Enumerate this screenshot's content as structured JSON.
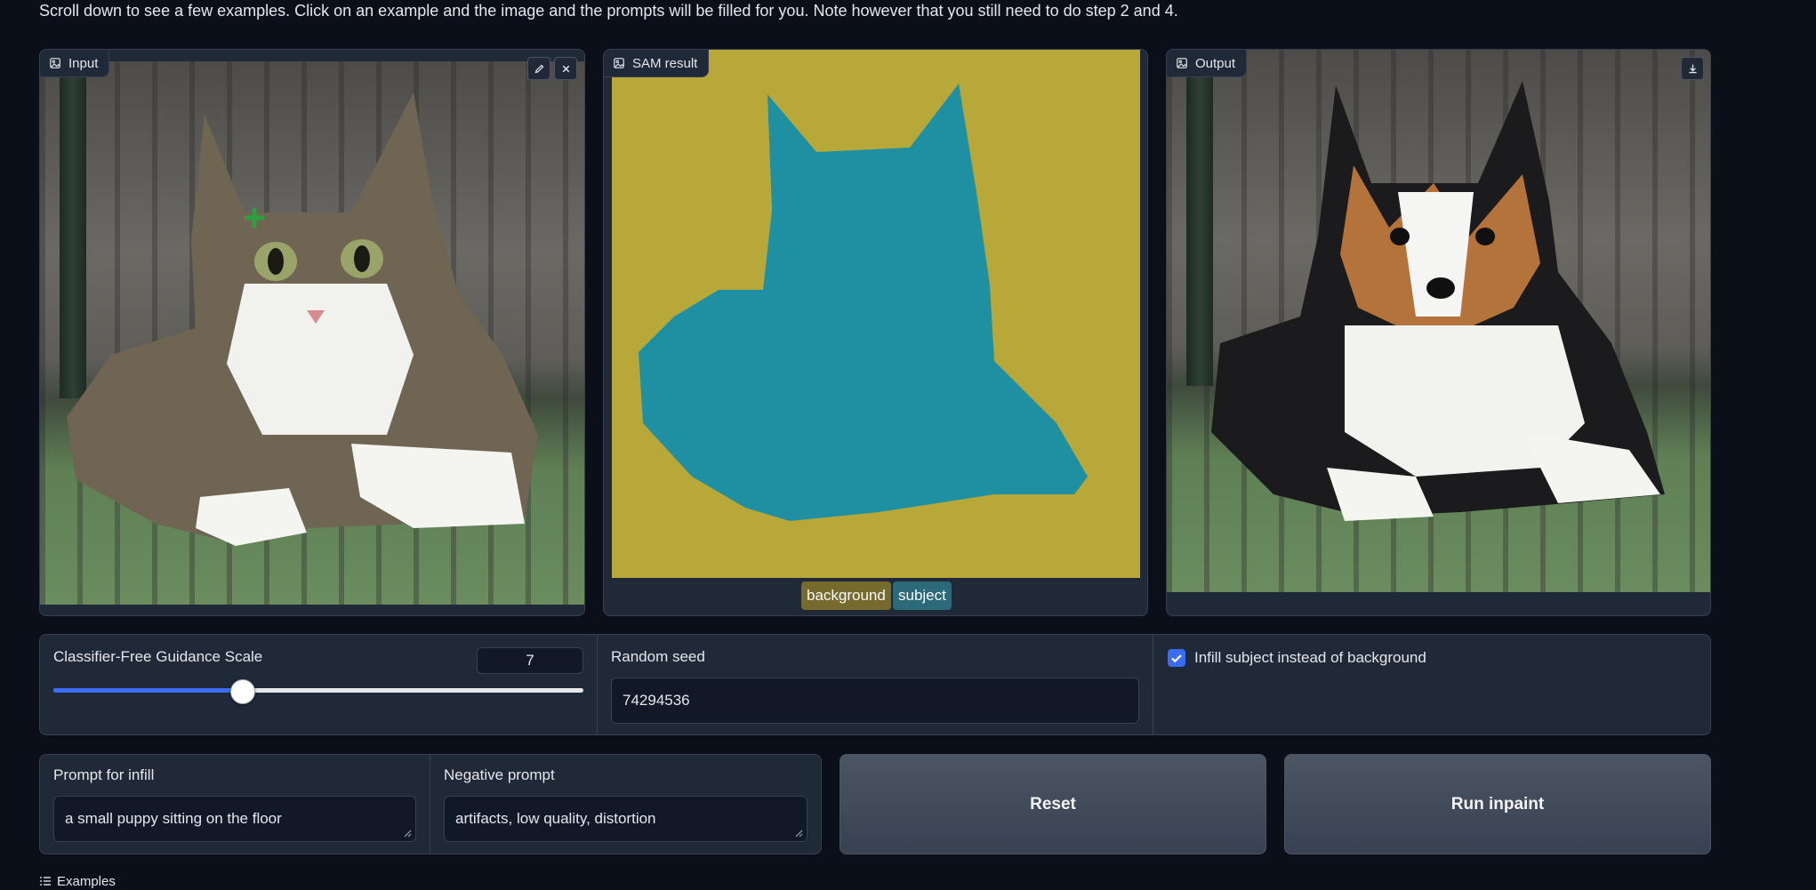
{
  "intro_text": "Scroll down to see a few examples. Click on an example and the image and the prompts will be filled for you. Note however that you still need to do step 2 and 4.",
  "input_panel": {
    "label": "Input",
    "icon": "image-icon",
    "tools": [
      "pencil-icon",
      "close-icon"
    ]
  },
  "sam_panel": {
    "label": "SAM result",
    "icon": "image-icon",
    "legend": [
      {
        "label": "background",
        "color": "#b8a83a"
      },
      {
        "label": "subject",
        "color": "#1f8fa2"
      }
    ]
  },
  "output_panel": {
    "label": "Output",
    "icon": "image-icon",
    "tools": [
      "download-icon"
    ]
  },
  "guidance": {
    "label": "Classifier-Free Guidance Scale",
    "value": "7",
    "level": 0.35
  },
  "seed": {
    "label": "Random seed",
    "value": "74294536"
  },
  "infill_checkbox": {
    "label": "Infill subject instead of background",
    "checked": true
  },
  "prompt": {
    "label": "Prompt for infill",
    "value": "a small puppy sitting on the floor"
  },
  "negative_prompt": {
    "label": "Negative prompt",
    "value": "artifacts, low quality, distortion"
  },
  "buttons": {
    "reset": "Reset",
    "run": "Run inpaint"
  },
  "examples": {
    "label": "Examples"
  },
  "colors": {
    "accent": "#3b6cf6",
    "sam_background": "#b8a83a",
    "sam_subject": "#1f8fa2"
  }
}
